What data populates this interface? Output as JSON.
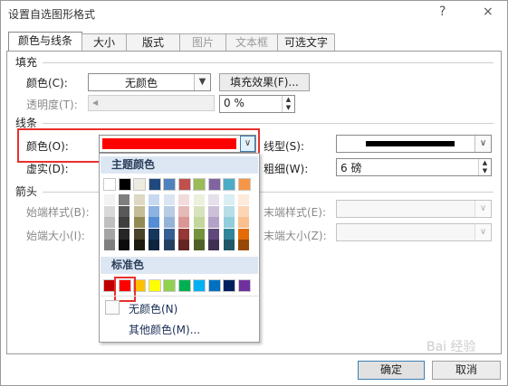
{
  "window": {
    "title": "设置自选图形格式",
    "help": "?",
    "close": "×"
  },
  "tabs": [
    {
      "label": "颜色与线条",
      "active": true
    },
    {
      "label": "大小"
    },
    {
      "label": "版式"
    },
    {
      "label": "图片",
      "disabled": true
    },
    {
      "label": "文本框",
      "disabled": true
    },
    {
      "label": "可选文字"
    }
  ],
  "fill": {
    "section": "填充",
    "color_label": "颜色(C):",
    "color_value": "无颜色",
    "effects_button": "填充效果(F)...",
    "transparency_label": "透明度(T):",
    "transparency_value": "0 %"
  },
  "line": {
    "section": "线条",
    "color_label": "颜色(O):",
    "color_value": "#ff0000",
    "dash_label": "虚实(D):",
    "style_label": "线型(S):",
    "weight_label": "粗细(W):",
    "weight_value": "6 磅"
  },
  "arrows": {
    "section": "箭头",
    "begin_style": "始端样式(B):",
    "end_style": "末端样式(E):",
    "begin_size": "始端大小(I):",
    "end_size": "末端大小(Z):"
  },
  "color_popup": {
    "theme_header": "主题颜色",
    "standard_header": "标准色",
    "no_color": "无颜色(N)",
    "more_colors": "其他颜色(M)...",
    "theme_top": [
      "#ffffff",
      "#000000",
      "#eeece1",
      "#1f497d",
      "#4f81bd",
      "#c0504d",
      "#9bbb59",
      "#8064a2",
      "#4bacc6",
      "#f79646"
    ],
    "theme_shades": [
      [
        "#f2f2f2",
        "#d8d8d8",
        "#bfbfbf",
        "#a5a5a5",
        "#7f7f7f"
      ],
      [
        "#7f7f7f",
        "#595959",
        "#3f3f3f",
        "#262626",
        "#0c0c0c"
      ],
      [
        "#ddd9c3",
        "#c4bd97",
        "#938953",
        "#494429",
        "#1d1b10"
      ],
      [
        "#c6d9f0",
        "#8db3e2",
        "#548dd4",
        "#17365d",
        "#0f243e"
      ],
      [
        "#dbe5f1",
        "#b8cce4",
        "#95b3d7",
        "#366092",
        "#244061"
      ],
      [
        "#f2dcdb",
        "#e5b9b7",
        "#d99694",
        "#953734",
        "#632423"
      ],
      [
        "#ebf1dd",
        "#d7e3bc",
        "#c3d69b",
        "#76923c",
        "#4f6128"
      ],
      [
        "#e5e0ec",
        "#ccc1d9",
        "#b2a2c7",
        "#5f497a",
        "#3f3151"
      ],
      [
        "#dbeef3",
        "#b7dde8",
        "#92cddc",
        "#31859b",
        "#205867"
      ],
      [
        "#fdeada",
        "#fbd5b5",
        "#fac08f",
        "#e36c09",
        "#974806"
      ]
    ],
    "standard": [
      "#c00000",
      "#ff0000",
      "#ffc000",
      "#ffff00",
      "#92d050",
      "#00b050",
      "#00b0f0",
      "#0070c0",
      "#002060",
      "#7030a0"
    ]
  },
  "buttons": {
    "ok": "确定",
    "cancel": "取消"
  },
  "watermark": "Bai 经验"
}
